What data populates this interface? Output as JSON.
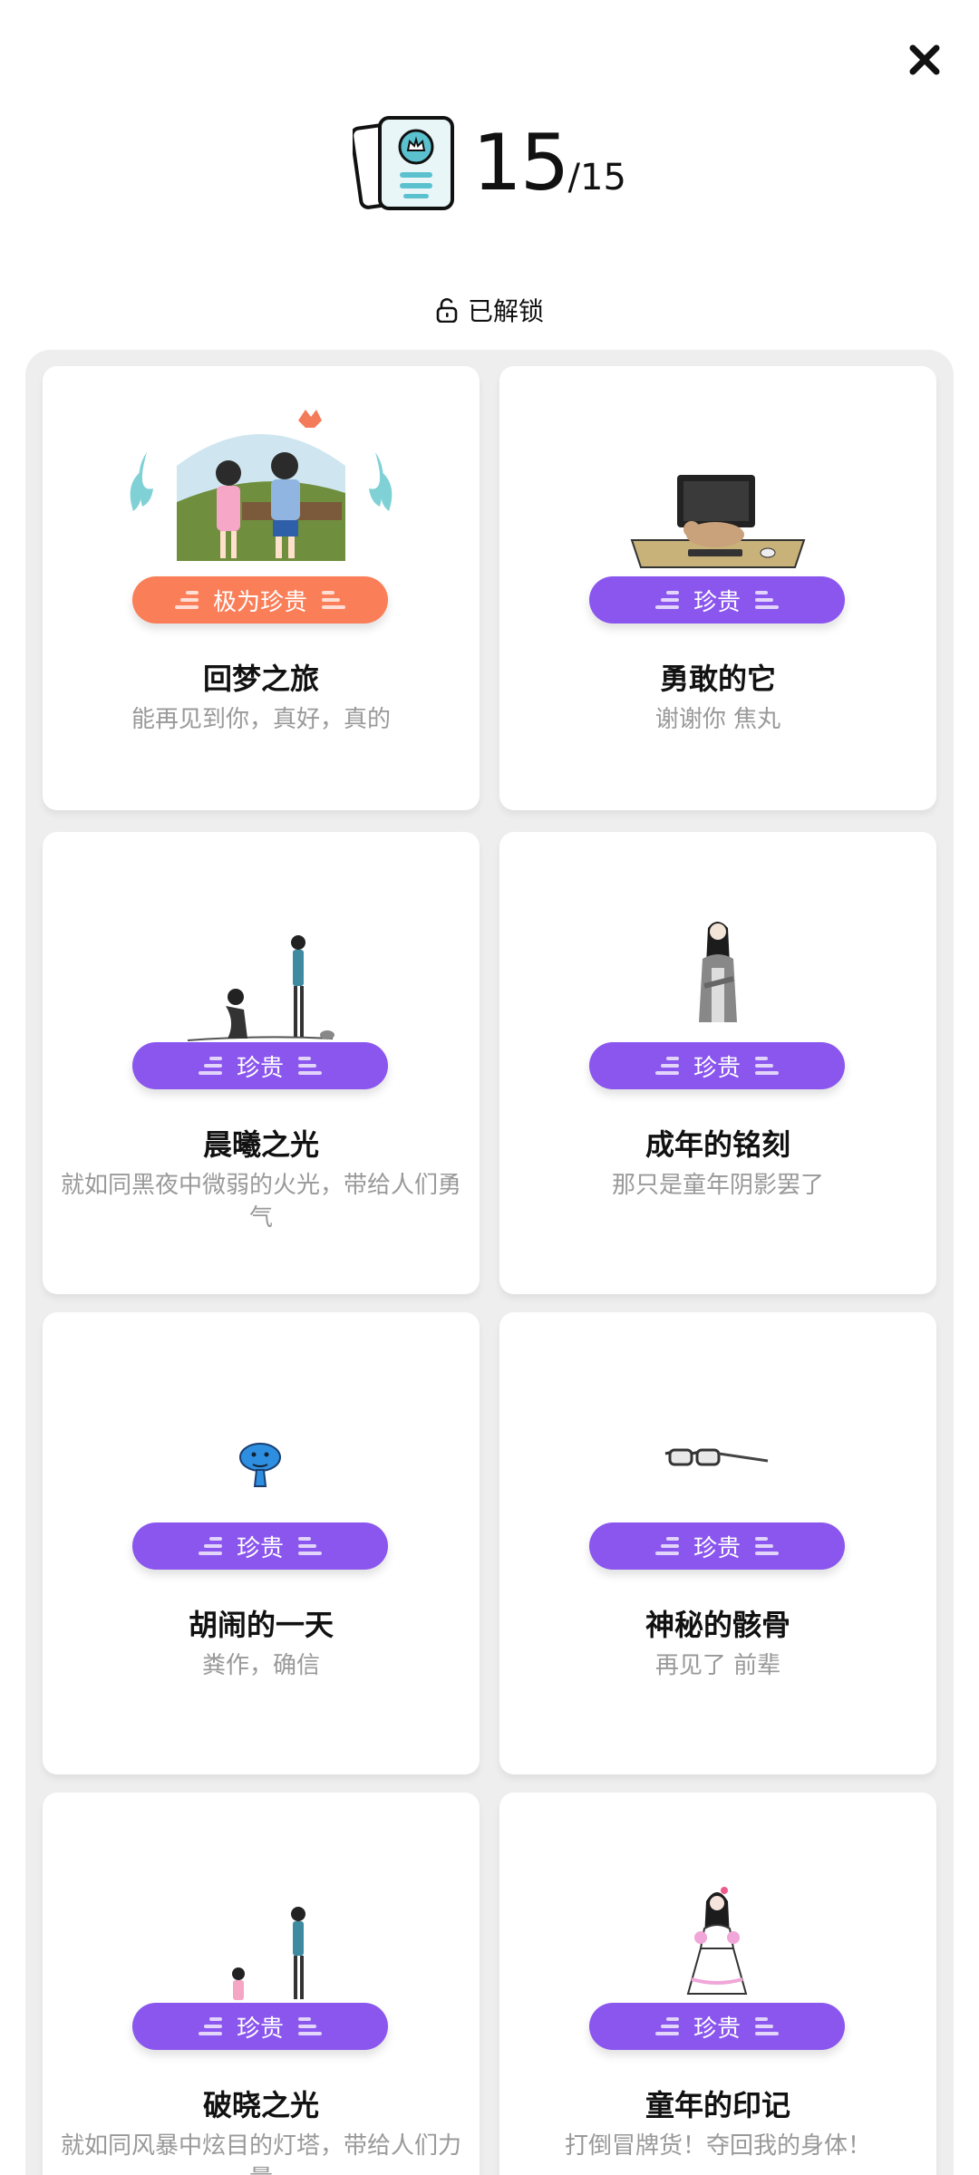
{
  "header": {
    "collected": "15",
    "total": "/15",
    "unlock_label": "已解锁"
  },
  "cards": [
    {
      "rarity": "极为珍贵",
      "title": "回梦之旅",
      "desc": "能再见到你，真好，真的"
    },
    {
      "rarity": "珍贵",
      "title": "勇敢的它",
      "desc": "谢谢你 焦丸"
    },
    {
      "rarity": "珍贵",
      "title": "晨曦之光",
      "desc": "就如同黑夜中微弱的火光，带给人们勇气"
    },
    {
      "rarity": "珍贵",
      "title": "成年的铭刻",
      "desc": "那只是童年阴影罢了"
    },
    {
      "rarity": "珍贵",
      "title": "胡闹的一天",
      "desc": "粪作，确信"
    },
    {
      "rarity": "珍贵",
      "title": "神秘的骸骨",
      "desc": "再见了 前辈"
    },
    {
      "rarity": "珍贵",
      "title": "破晓之光",
      "desc": "就如同风暴中炫目的灯塔，带给人们力量"
    },
    {
      "rarity": "珍贵",
      "title": "童年的印记",
      "desc": "打倒冒牌货！夺回我的身体！"
    }
  ],
  "colors": {
    "badge_rare": "#8a56ee",
    "badge_very_rare": "#fa7e58",
    "panel_bg": "#eeeeee",
    "desc_text": "#999999"
  },
  "icons": [
    "close-icon",
    "card-collection-icon",
    "unlock-icon",
    "illustration"
  ]
}
